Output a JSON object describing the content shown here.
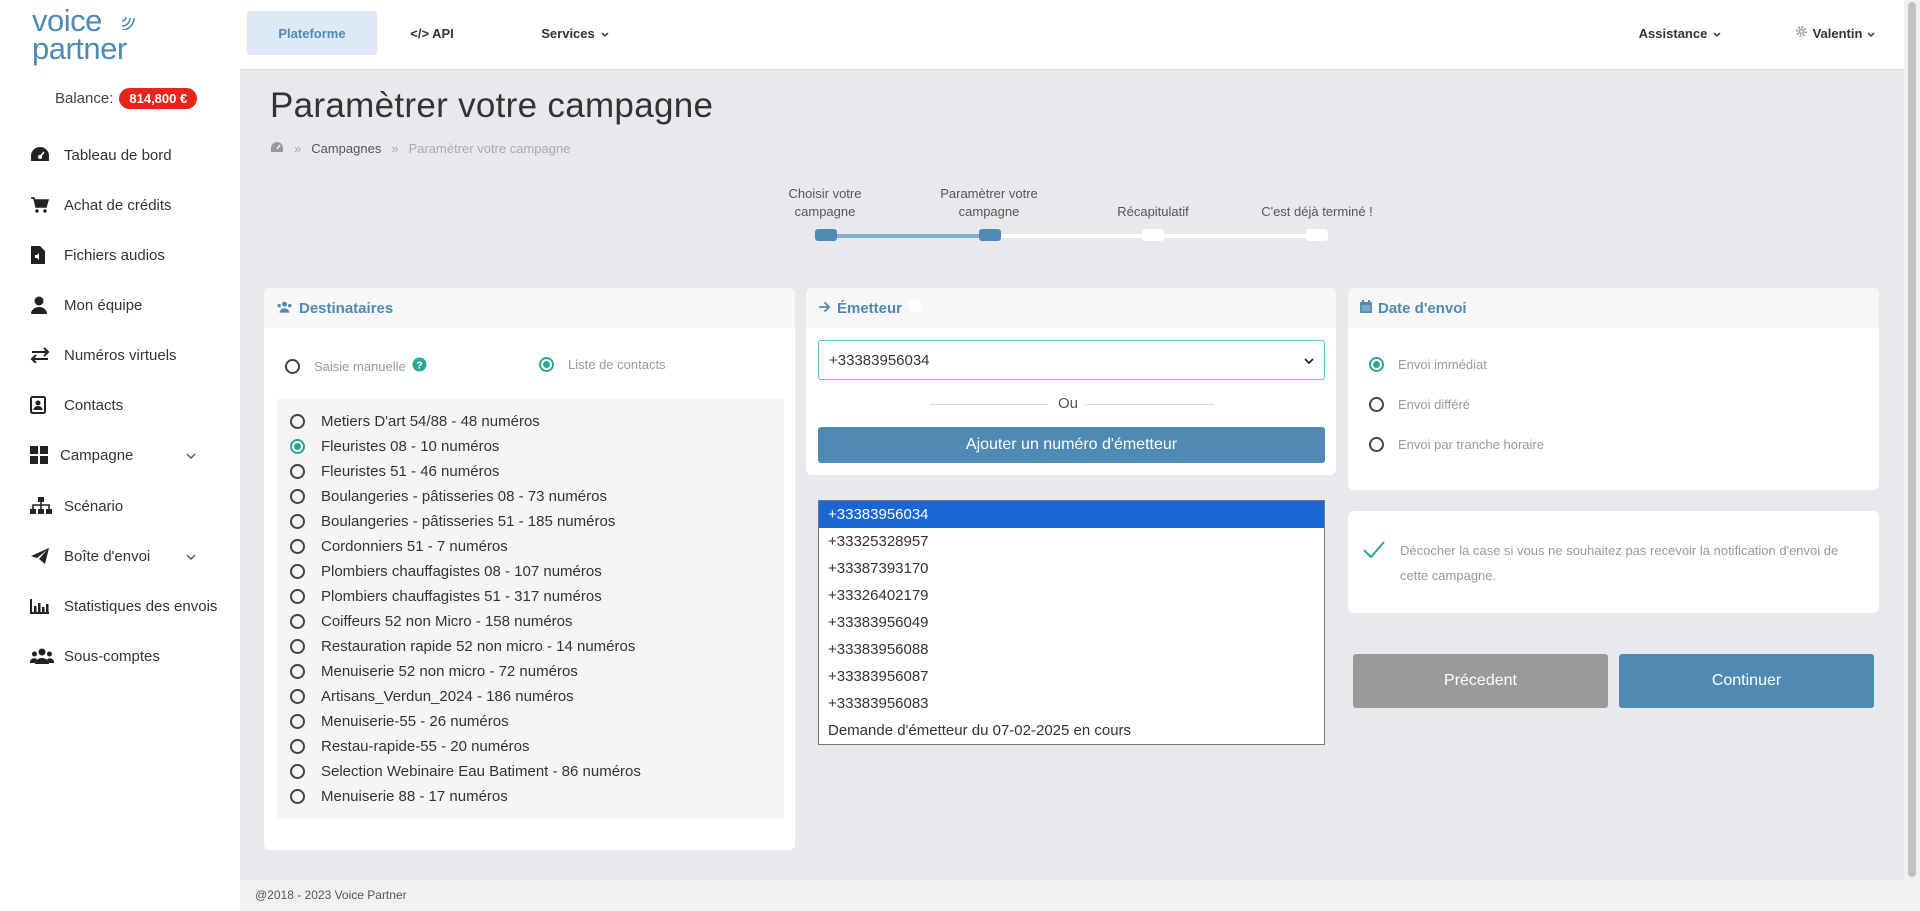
{
  "brand": {
    "logo_line1": "voice",
    "logo_line2": "partner"
  },
  "balance": {
    "label": "Balance:",
    "value": "814,800 €"
  },
  "sidebar": {
    "items": [
      {
        "label": "Tableau de bord",
        "icon": "dashboard-icon"
      },
      {
        "label": "Achat de crédits",
        "icon": "cart-icon"
      },
      {
        "label": "Fichiers audios",
        "icon": "audio-file-icon"
      },
      {
        "label": "Mon équipe",
        "icon": "user-icon"
      },
      {
        "label": "Numéros virtuels",
        "icon": "exchange-icon"
      },
      {
        "label": "Contacts",
        "icon": "contact-card-icon"
      },
      {
        "label": "Campagne",
        "icon": "grid-icon"
      },
      {
        "label": "Scénario",
        "icon": "sitemap-icon"
      },
      {
        "label": "Boîte d'envoi",
        "icon": "paper-plane-icon"
      },
      {
        "label": "Statistiques des envois",
        "icon": "bar-chart-icon"
      },
      {
        "label": "Sous-comptes",
        "icon": "users-icon"
      }
    ]
  },
  "topnav": {
    "tabs": [
      "Plateforme",
      "API",
      "Services"
    ],
    "assistance": "Assistance",
    "user": "Valentin"
  },
  "page": {
    "title": "Paramètrer votre campagne",
    "breadcrumb": [
      "Campagnes",
      "Paramètrer votre campagne"
    ],
    "breadcrumb_sep": "»"
  },
  "stepper": {
    "steps": [
      "Choisir votre campagne",
      "Paramètrer votre campagne",
      "Récapitulatif",
      "C'est déjà terminé !"
    ],
    "current": 2
  },
  "destinataires": {
    "title": "Destinataires",
    "modes": [
      "Saisie manuelle",
      "Liste de contacts"
    ],
    "selected_mode": 1,
    "lists": [
      "Metiers D'art 54/88 - 48 numéros",
      "Fleuristes 08 - 10 numéros",
      "Fleuristes 51 - 46 numéros",
      "Boulangeries - pâtisseries 08 - 73 numéros",
      "Boulangeries - pâtisseries 51 - 185 numéros",
      "Cordonniers 51 - 7 numéros",
      "Plombiers chauffagistes 08 - 107 numéros",
      "Plombiers chauffagistes 51 - 317 numéros",
      "Coiffeurs 52 non Micro - 158 numéros",
      "Restauration rapide 52 non micro - 14 numéros",
      "Menuiserie 52 non micro - 72 numéros",
      "Artisans_Verdun_2024 - 186 numéros",
      "Menuiserie-55 - 26 numéros",
      "Restau-rapide-55 - 20 numéros",
      "Selection Webinaire Eau Batiment - 86 numéros",
      "Menuiserie 88 - 17 numéros"
    ],
    "selected_list": 1
  },
  "emetteur": {
    "title": "Émetteur",
    "selected": "+33383956034",
    "or_label": "Ou",
    "add_button": "Ajouter un numéro d'émetteur",
    "options": [
      "+33383956034",
      "+33325328957",
      "+33387393170",
      "+33326402179",
      "+33383956049",
      "+33383956088",
      "+33383956087",
      "+33383956083",
      "Demande d'émetteur du 07-02-2025 en cours"
    ]
  },
  "date_envoi": {
    "title": "Date d'envoi",
    "options": [
      "Envoi immédiat",
      "Envoi différé",
      "Envoi par tranche horaire"
    ],
    "selected": 0
  },
  "notification": {
    "text": "Décocher la case si vous ne souhaitez pas recevoir la notification d'envoi de cette campagne.",
    "checked": true
  },
  "actions": {
    "previous": "Précedent",
    "continue": "Continuer"
  },
  "footer": {
    "text": "@2018 - 2023 Voice Partner"
  },
  "colors": {
    "accent": "#4f8ab3",
    "teal": "#2ba79a",
    "badge": "#e5261f",
    "selected_option": "#1a66d2"
  }
}
